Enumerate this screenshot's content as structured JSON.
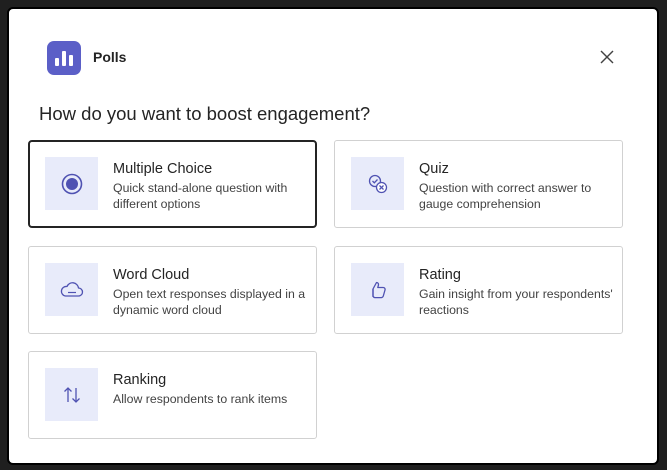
{
  "app": {
    "title": "Polls",
    "icon": "polls-bar-chart-icon",
    "accent_color": "#5b5fc7"
  },
  "close_icon": "close-icon",
  "heading": "How do you want to boost engagement?",
  "options": [
    {
      "title": "Multiple Choice",
      "description": "Quick stand-alone question with different options",
      "icon": "radio-button-icon",
      "selected": true
    },
    {
      "title": "Quiz",
      "description": "Question with correct answer to gauge comprehension",
      "icon": "quiz-check-icon",
      "selected": false
    },
    {
      "title": "Word Cloud",
      "description": "Open text responses displayed in a dynamic word cloud",
      "icon": "cloud-icon",
      "selected": false
    },
    {
      "title": "Rating",
      "description": "Gain insight from your respondents' reactions",
      "icon": "thumbs-up-icon",
      "selected": false
    },
    {
      "title": "Ranking",
      "description": "Allow respondents to rank items",
      "icon": "sort-arrows-icon",
      "selected": false
    }
  ],
  "colors": {
    "icon_tile_background": "#e8ebfa",
    "icon_color": "#4f52b2",
    "card_border": "#d1d1d1",
    "selected_border": "#242424"
  }
}
